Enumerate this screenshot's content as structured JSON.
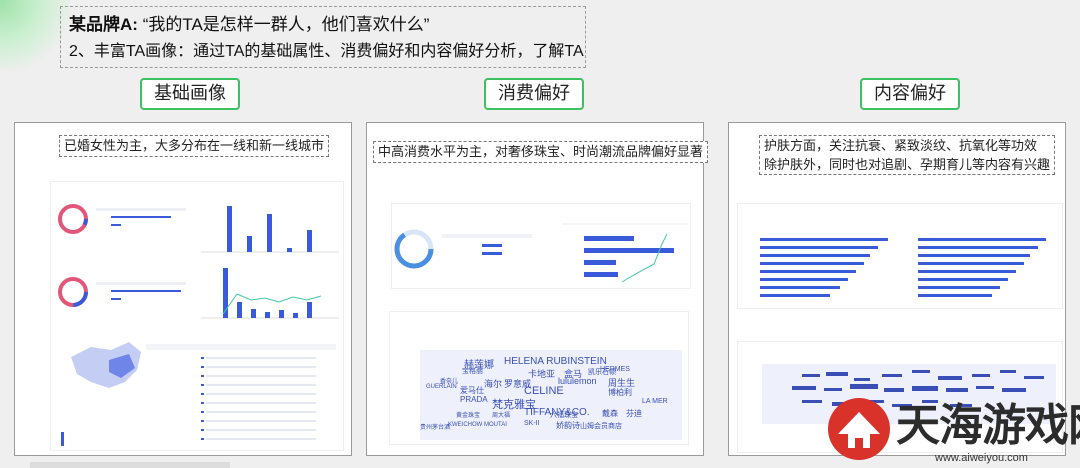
{
  "header": {
    "brand_label": "某品牌A:",
    "question": "“我的TA是怎样一群人，他们喜欢什么”",
    "subtitle": "2、丰富TA画像：通过TA的基础属性、消费偏好和内容偏好分析，了解TA"
  },
  "sections": [
    {
      "label": "基础画像",
      "caption": "已婚女性为主，大多分布在一线和新一线城市"
    },
    {
      "label": "消费偏好",
      "caption": "中高消费水平为主，对奢侈珠宝、时尚潮流品牌偏好显著"
    },
    {
      "label": "内容偏好",
      "caption_line1": "护肤方面，关注抗衰、紧致淡纹、抗氧化等功效",
      "caption_line2": "除护肤外，同时也对追剧、孕期育儿等内容有兴趣"
    }
  ],
  "brand_cloud": {
    "words": [
      "赫莲娜",
      "HELENA RUBINSTEIN",
      "HERMES",
      "宝格丽",
      "卡地亚",
      "盒马",
      "凯乐石顿",
      "香奈儿",
      "海尔",
      "罗意威",
      "lululemon",
      "周生生",
      "GUERLAIN",
      "爱马仕",
      "CELINE",
      "博柏利",
      "PRADA",
      "梵克雅宝",
      "TIFFANY&CO.",
      "戴森",
      "芬迪",
      "LA MER",
      "黄金珠宝",
      "周大福",
      "SK-II",
      "娇韵诗",
      "KWEICHOW MOUTAI",
      "山姆会员商店",
      "贵州茅台酒",
      "六福珠宝"
    ]
  },
  "watermark": {
    "site_name": "天海游戏网",
    "url": "www.aiweiyou.com"
  },
  "colors": {
    "accent_green": "#3cc160",
    "chart_blue": "#3a5bd9",
    "donut_pink": "#e2567a",
    "watermark_red": "#d8322b"
  }
}
